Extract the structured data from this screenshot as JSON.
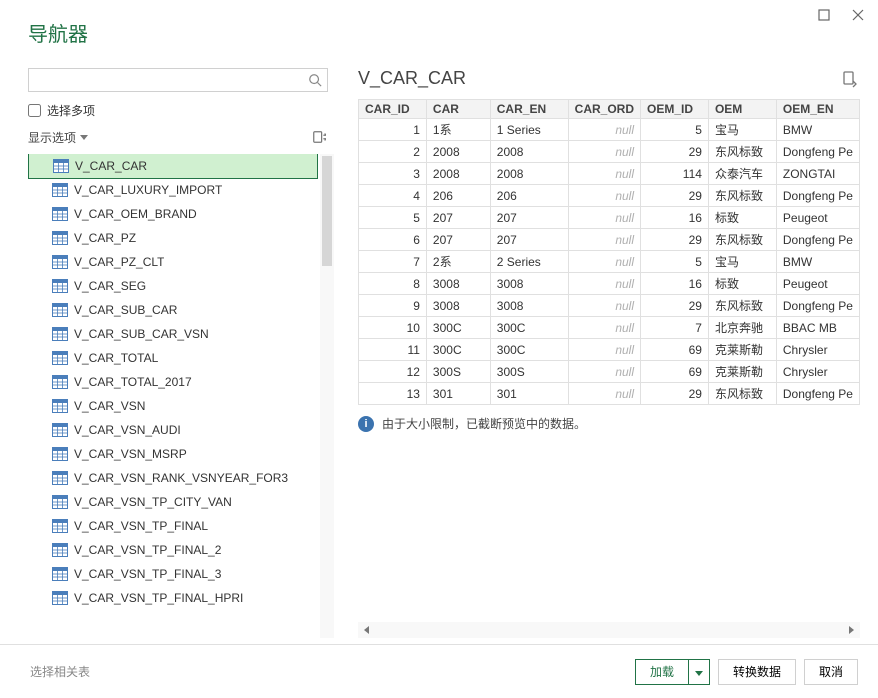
{
  "window_title": "导航器",
  "search_placeholder": "",
  "select_multiple_label": "选择多项",
  "display_options_label": "显示选项",
  "tree_selected": "V_CAR_CAR",
  "tree_items": [
    "V_CAR_CAR",
    "V_CAR_LUXURY_IMPORT",
    "V_CAR_OEM_BRAND",
    "V_CAR_PZ",
    "V_CAR_PZ_CLT",
    "V_CAR_SEG",
    "V_CAR_SUB_CAR",
    "V_CAR_SUB_CAR_VSN",
    "V_CAR_TOTAL",
    "V_CAR_TOTAL_2017",
    "V_CAR_VSN",
    "V_CAR_VSN_AUDI",
    "V_CAR_VSN_MSRP",
    "V_CAR_VSN_RANK_VSNYEAR_FOR3",
    "V_CAR_VSN_TP_CITY_VAN",
    "V_CAR_VSN_TP_FINAL",
    "V_CAR_VSN_TP_FINAL_2",
    "V_CAR_VSN_TP_FINAL_3",
    "V_CAR_VSN_TP_FINAL_HPRI"
  ],
  "preview_title": "V_CAR_CAR",
  "columns": [
    "CAR_ID",
    "CAR",
    "CAR_EN",
    "CAR_ORD",
    "OEM_ID",
    "OEM",
    "OEM_EN"
  ],
  "null_text": "null",
  "rows": [
    {
      "CAR_ID": 1,
      "CAR": "1系",
      "CAR_EN": "1 Series",
      "CAR_ORD": null,
      "OEM_ID": 5,
      "OEM": "宝马",
      "OEM_EN": "BMW"
    },
    {
      "CAR_ID": 2,
      "CAR": "2008",
      "CAR_EN": "2008",
      "CAR_ORD": null,
      "OEM_ID": 29,
      "OEM": "东风标致",
      "OEM_EN": "Dongfeng Pe"
    },
    {
      "CAR_ID": 3,
      "CAR": "2008",
      "CAR_EN": "2008",
      "CAR_ORD": null,
      "OEM_ID": 114,
      "OEM": "众泰汽车",
      "OEM_EN": "ZONGTAI"
    },
    {
      "CAR_ID": 4,
      "CAR": "206",
      "CAR_EN": "206",
      "CAR_ORD": null,
      "OEM_ID": 29,
      "OEM": "东风标致",
      "OEM_EN": "Dongfeng Pe"
    },
    {
      "CAR_ID": 5,
      "CAR": "207",
      "CAR_EN": "207",
      "CAR_ORD": null,
      "OEM_ID": 16,
      "OEM": "标致",
      "OEM_EN": "Peugeot"
    },
    {
      "CAR_ID": 6,
      "CAR": "207",
      "CAR_EN": "207",
      "CAR_ORD": null,
      "OEM_ID": 29,
      "OEM": "东风标致",
      "OEM_EN": "Dongfeng Pe"
    },
    {
      "CAR_ID": 7,
      "CAR": "2系",
      "CAR_EN": "2 Series",
      "CAR_ORD": null,
      "OEM_ID": 5,
      "OEM": "宝马",
      "OEM_EN": "BMW"
    },
    {
      "CAR_ID": 8,
      "CAR": "3008",
      "CAR_EN": "3008",
      "CAR_ORD": null,
      "OEM_ID": 16,
      "OEM": "标致",
      "OEM_EN": "Peugeot"
    },
    {
      "CAR_ID": 9,
      "CAR": "3008",
      "CAR_EN": "3008",
      "CAR_ORD": null,
      "OEM_ID": 29,
      "OEM": "东风标致",
      "OEM_EN": "Dongfeng Pe"
    },
    {
      "CAR_ID": 10,
      "CAR": "300C",
      "CAR_EN": "300C",
      "CAR_ORD": null,
      "OEM_ID": 7,
      "OEM": "北京奔驰",
      "OEM_EN": "BBAC MB"
    },
    {
      "CAR_ID": 11,
      "CAR": "300C",
      "CAR_EN": "300C",
      "CAR_ORD": null,
      "OEM_ID": 69,
      "OEM": "克莱斯勒",
      "OEM_EN": "Chrysler"
    },
    {
      "CAR_ID": 12,
      "CAR": "300S",
      "CAR_EN": "300S",
      "CAR_ORD": null,
      "OEM_ID": 69,
      "OEM": "克莱斯勒",
      "OEM_EN": "Chrysler"
    },
    {
      "CAR_ID": 13,
      "CAR": "301",
      "CAR_EN": "301",
      "CAR_ORD": null,
      "OEM_ID": 29,
      "OEM": "东风标致",
      "OEM_EN": "Dongfeng Pe"
    }
  ],
  "truncation_note": "由于大小限制，已截断预览中的数据。",
  "footer": {
    "select_related": "选择相关表",
    "load": "加载",
    "transform": "转换数据",
    "cancel": "取消"
  }
}
